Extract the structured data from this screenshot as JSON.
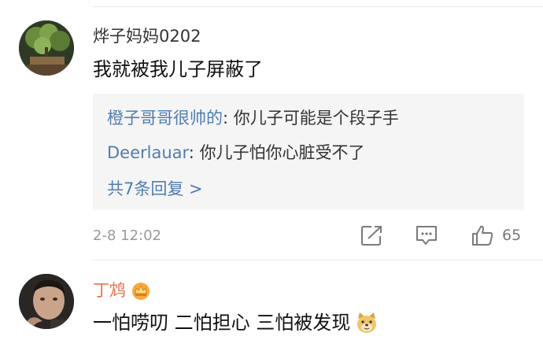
{
  "comments": [
    {
      "username": "烨子妈妈0202",
      "content": "我就被我儿子屏蔽了",
      "replies": [
        {
          "name": "橙子哥哥很帅的",
          "separator": ": ",
          "text": "你儿子可能是个段子手"
        },
        {
          "name": "Deerlauar",
          "separator": ": ",
          "text": "你儿子怕你心脏受不了"
        }
      ],
      "reply_count_label": "共7条回复 >",
      "timestamp": "2-8 12:02",
      "like_count": "65"
    },
    {
      "username": "丁鸩",
      "username_color": "#eb7350",
      "content": "一怕唠叨 二怕担心 三怕被发现"
    }
  ],
  "colors": {
    "link_blue": "#507daf",
    "vip_orange": "#eb7350",
    "reply_bg": "#f5f5f5"
  },
  "icons": {
    "share": "share-icon",
    "comment": "comment-icon",
    "like": "thumbs-up-icon",
    "crown": "crown-badge-icon",
    "emoji": "doge-emoji-icon"
  }
}
